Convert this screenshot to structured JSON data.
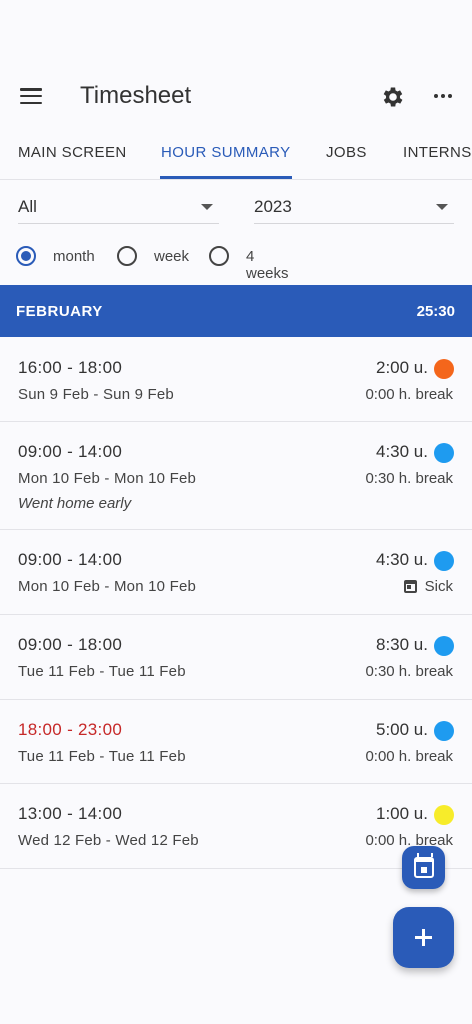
{
  "app": {
    "title": "Timesheet"
  },
  "tabs": [
    "MAIN SCREEN",
    "HOUR SUMMARY",
    "JOBS",
    "INTERNS"
  ],
  "active_tab": "HOUR SUMMARY",
  "filters": {
    "job": "All",
    "year": "2023"
  },
  "period_options": [
    {
      "label": "month",
      "selected": true
    },
    {
      "label": "week",
      "selected": false
    },
    {
      "label": "4 weeks",
      "selected": false
    }
  ],
  "summary": {
    "month": "FEBRUARY",
    "total": "25:30"
  },
  "entries": [
    {
      "time": "16:00 - 18:00",
      "dates": "Sun 9 Feb - Sun 9 Feb",
      "hours": "2:00 u.",
      "detail": "0:00 h. break",
      "color": "#f4661b",
      "note": ""
    },
    {
      "time": "09:00 - 14:00",
      "dates": "Mon 10 Feb - Mon 10 Feb",
      "hours": "4:30 u.",
      "detail": "0:30 h. break",
      "color": "#1e9bf0",
      "note": "Went home early"
    },
    {
      "time": "09:00 - 14:00",
      "dates": "Mon 10 Feb - Mon 10 Feb",
      "hours": "4:30 u.",
      "detail": "Sick",
      "color": "#1e9bf0",
      "note": ""
    },
    {
      "time": "09:00 - 18:00",
      "dates": "Tue 11 Feb - Tue 11 Feb",
      "hours": "8:30 u.",
      "detail": "0:30 h. break",
      "color": "#1e9bf0",
      "note": ""
    },
    {
      "time": "18:00 - 23:00",
      "dates": "Tue 11 Feb - Tue 11 Feb",
      "hours": "5:00 u.",
      "detail": "0:00 h. break",
      "color": "#1e9bf0",
      "note": ""
    },
    {
      "time": "13:00 - 14:00",
      "dates": "Wed 12 Feb - Wed 12 Feb",
      "hours": "1:00 u.",
      "detail": "0:00 h. break",
      "color": "#f7ec2a",
      "note": ""
    }
  ],
  "icons": {
    "menu": "hamburger-menu-icon",
    "settings": "gear-icon",
    "more": "more-horizontal-icon",
    "calendar": "calendar-icon",
    "add": "plus-icon"
  },
  "colors": {
    "accent": "#2a5bb8",
    "overtime": "#c62828"
  }
}
